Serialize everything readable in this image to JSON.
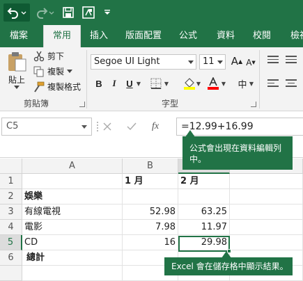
{
  "qat": {
    "undo_icon": "undo-icon",
    "redo_icon": "redo-icon",
    "save_icon": "save-icon",
    "screen_icon": "touch-mode-icon",
    "customize_icon": "customize-qat-icon"
  },
  "tabs": [
    "檔案",
    "常用",
    "插入",
    "版面配置",
    "公式",
    "資料",
    "校閱",
    "檢視"
  ],
  "active_tab": "常用",
  "clipboard": {
    "paste": "貼上",
    "cut": "剪下",
    "copy": "複製",
    "format_painter": "複製格式",
    "group_label": "剪貼簿"
  },
  "font": {
    "family": "Segoe UI Light",
    "size": "11",
    "bold": "B",
    "italic": "I",
    "underline": "U",
    "group_label": "字型",
    "phonetic": "中"
  },
  "formula_bar": {
    "name_box": "C5",
    "fx": "fx",
    "formula": "=12.99+16.99"
  },
  "callouts": {
    "formula": "公式會出現在資料編輯列中。",
    "result": "Excel 會在儲存格中顯示結果。"
  },
  "columns": [
    "A",
    "B",
    "C"
  ],
  "rows": [
    {
      "num": "1",
      "a": "",
      "b": "1 月",
      "c": "2 月"
    },
    {
      "num": "2",
      "a": "娛樂",
      "b": "",
      "c": ""
    },
    {
      "num": "3",
      "a": "有線電視",
      "b": "52.98",
      "c": "63.25"
    },
    {
      "num": "4",
      "a": "電影",
      "b": "7.98",
      "c": "11.97"
    },
    {
      "num": "5",
      "a": "CD",
      "b": "16",
      "c": "29.98"
    },
    {
      "num": "6",
      "a": "總計",
      "b": "",
      "c": ""
    }
  ],
  "colors": {
    "excel_green": "#217346",
    "highlight_yellow": "#ffff00",
    "font_red": "#ff0000"
  }
}
